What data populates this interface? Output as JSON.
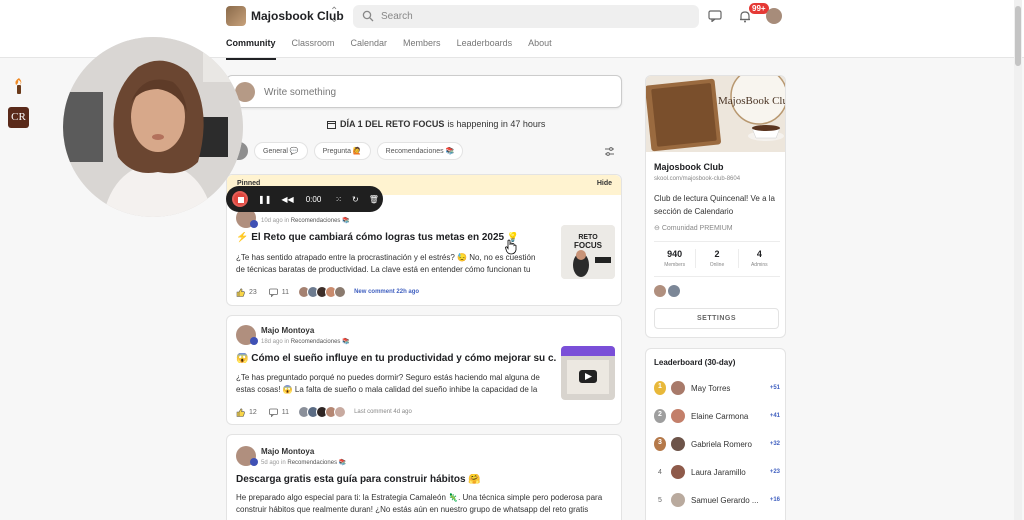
{
  "header": {
    "club_name": "Majosbook Club",
    "search_placeholder": "Search",
    "notif_count": "99+"
  },
  "nav": {
    "tabs": [
      {
        "label": "Community",
        "active": true
      },
      {
        "label": "Classroom"
      },
      {
        "label": "Calendar"
      },
      {
        "label": "Members"
      },
      {
        "label": "Leaderboards"
      },
      {
        "label": "About"
      }
    ]
  },
  "composer": {
    "placeholder": "Write something"
  },
  "event": {
    "title": "DÍA 1 DEL RETO FOCUS",
    "suffix": "is happening in 47 hours"
  },
  "filters": [
    "General 💬",
    "Pregunta 🙋",
    "Recomendaciones 📚"
  ],
  "recorder": {
    "time": "0:00"
  },
  "posts": [
    {
      "pinned_label": "Pinned",
      "hide_label": "Hide",
      "author": "",
      "meta_time": "10d ago",
      "meta_in": "in",
      "category": "Recomendaciones 📚",
      "title": "⚡ El Reto que cambiará cómo logras tus metas en 2025 💡",
      "body": "¿Te has sentido atrapado entre la procrastinación y el estrés? 😓 No, no es cuestión de técnicas baratas de productividad. La clave está en entender cómo funcionan tu",
      "likes": "23",
      "comments": "11",
      "activity": "New comment 22h ago",
      "thumb_text": "RETO FOCUS"
    },
    {
      "author": "Majo Montoya",
      "meta_time": "18d ago",
      "meta_in": "in",
      "category": "Recomendaciones 📚",
      "title": "😱 Cómo el sueño influye en tu productividad y cómo mejorar su c...",
      "body": "¿Te has preguntado porqué no puedes dormir? Seguro estás haciendo mal alguna de estas cosas! 😱 La falta de sueño o mala calidad del sueño inhibe la capacidad de la",
      "likes": "12",
      "comments": "11",
      "activity": "Last comment 4d ago"
    },
    {
      "author": "Majo Montoya",
      "meta_time": "5d ago",
      "meta_in": "in",
      "category": "Recomendaciones 📚",
      "title": "Descarga gratis esta guía para construir hábitos 🤗",
      "body": "He preparado algo especial para ti: la Estrategia Camaleón 🦎. Una técnica simple pero poderosa para construir hábitos que realmente duran! ¿No estás aún en nuestro grupo de whatsapp del reto gratis"
    }
  ],
  "club_card": {
    "cover_title": "MajosBook Club",
    "name": "Majosbook Club",
    "url": "skool.com/majosbook-club-8604",
    "description": "Club de lectura Quincenal! Ve a la sección de Calendario",
    "privacy": "Comunidad PREMIUM",
    "stats": [
      {
        "n": "940",
        "l": "Members"
      },
      {
        "n": "2",
        "l": "Online"
      },
      {
        "n": "4",
        "l": "Admins"
      }
    ],
    "settings_label": "SETTINGS"
  },
  "leaderboard": {
    "title": "Leaderboard (30-day)",
    "rows": [
      {
        "rank": "1",
        "name": "May Torres",
        "pts": "+51"
      },
      {
        "rank": "2",
        "name": "Elaine Carmona",
        "pts": "+41"
      },
      {
        "rank": "3",
        "name": "Gabriela Romero",
        "pts": "+32"
      },
      {
        "rank": "4",
        "name": "Laura Jaramillo",
        "pts": "+23"
      },
      {
        "rank": "5",
        "name": "Samuel Gerardo ...",
        "pts": "+16"
      }
    ]
  },
  "sidebar": {
    "cr_label": "CR"
  },
  "colors": {
    "accent_blue": "#4060c0",
    "pinned_bg": "#fff3d0",
    "badge_red": "#e53935",
    "gold": "#e8b83a",
    "silver": "#9e9e9e",
    "bronze": "#b5794a"
  }
}
